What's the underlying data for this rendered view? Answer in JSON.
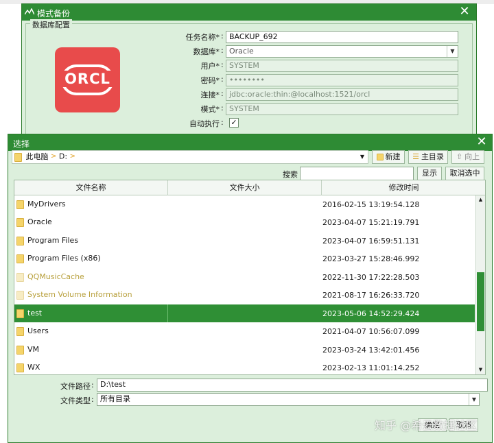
{
  "backup_window": {
    "title": "模式备份",
    "group_label": "数据库配置",
    "logo_text": "ORCL",
    "fields": [
      {
        "label": "任务名称*",
        "value": "BACKUP_692"
      },
      {
        "label": "数据库*",
        "value": "Oracle"
      },
      {
        "label": "用户*",
        "value": "SYSTEM"
      },
      {
        "label": "密码*",
        "value": "••••••••"
      },
      {
        "label": "连接*",
        "value": "jdbc:oracle:thin:@localhost:1521/orcl"
      },
      {
        "label": "模式*",
        "value": "SYSTEM"
      },
      {
        "label": "自动执行",
        "value": "✓"
      }
    ]
  },
  "chooser": {
    "title": "选择",
    "path_root": "此电脑",
    "path_drive": "D:",
    "toolbar": {
      "new": "新建",
      "home": "主目录",
      "up": "向上"
    },
    "search_label": "搜索",
    "show_btn": "显示",
    "deselect_btn": "取消选中",
    "columns": {
      "name": "文件名称",
      "size": "文件大小",
      "time": "修改时间"
    },
    "files": [
      {
        "name": "MyDrivers",
        "time": "2016-02-15 13:19:54.128"
      },
      {
        "name": "Oracle",
        "time": "2023-04-07 15:21:19.791"
      },
      {
        "name": "Program Files",
        "time": "2023-04-07 16:59:51.131"
      },
      {
        "name": "Program Files (x86)",
        "time": "2023-03-27 15:28:46.992"
      },
      {
        "name": "QQMusicCache",
        "time": "2022-11-30 17:22:28.503"
      },
      {
        "name": "System Volume Information",
        "time": "2021-08-17 16:26:33.720"
      },
      {
        "name": "test",
        "time": "2023-05-06 14:52:29.424"
      },
      {
        "name": "Users",
        "time": "2021-04-07 10:56:07.099"
      },
      {
        "name": "VM",
        "time": "2023-03-24 13:42:01.456"
      },
      {
        "name": "WX",
        "time": "2023-02-13 11:01:14.252"
      }
    ],
    "path_label": "文件路径",
    "path_value": "D:\\test",
    "type_label": "文件类型",
    "type_value": "所有目录",
    "ok_btn": "确定",
    "cancel_btn": "取消"
  },
  "watermark": "知乎 @希云数据社区",
  "colors": {
    "title_green": "#2e8b34",
    "panel_green": "#dcefdc",
    "selected_row": "#2f8f35",
    "logo_red": "#e84b4b"
  }
}
